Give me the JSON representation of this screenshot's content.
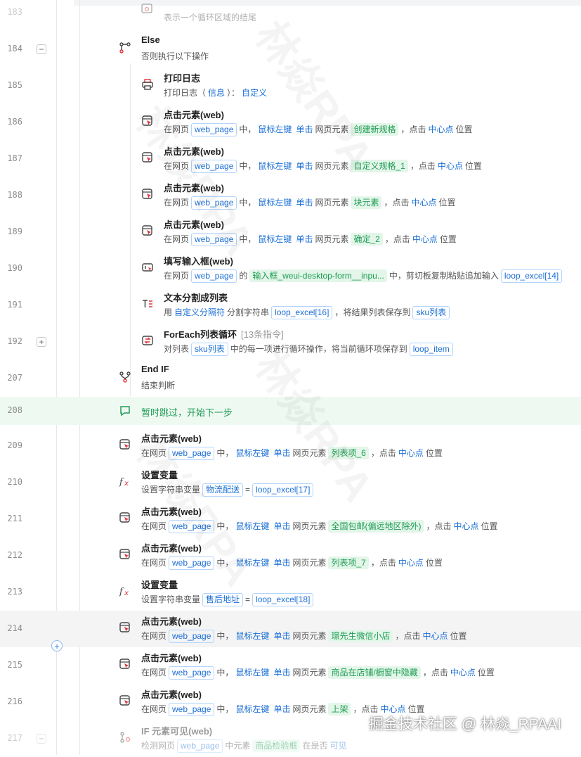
{
  "top_partial_desc": "表示一个循环区域的结尾",
  "top_partial_line": "183",
  "rows": [
    {
      "line": "184",
      "title": "Else",
      "desc": [
        {
          "t": "txt",
          "v": "否则执行以下操作"
        }
      ]
    },
    {
      "line": "185",
      "title": "打印日志",
      "desc": [
        {
          "t": "txt",
          "v": "打印日志（"
        },
        {
          "t": "link",
          "v": "信息"
        },
        {
          "t": "txt",
          "v": "）："
        },
        {
          "t": "link",
          "v": "自定义"
        }
      ]
    },
    {
      "line": "186",
      "title": "点击元素(web)",
      "desc": [
        {
          "t": "txt",
          "v": "在网页"
        },
        {
          "t": "tagb",
          "v": "web_page"
        },
        {
          "t": "txt",
          "v": "中，"
        },
        {
          "t": "link",
          "v": "鼠标左键"
        },
        {
          "t": "link",
          "v": "单击"
        },
        {
          "t": "txt",
          "v": "网页元素"
        },
        {
          "t": "tagg",
          "v": "创建新规格"
        },
        {
          "t": "txt",
          "v": "，点击"
        },
        {
          "t": "link",
          "v": "中心点"
        },
        {
          "t": "txt",
          "v": "位置"
        }
      ]
    },
    {
      "line": "187",
      "title": "点击元素(web)",
      "desc": [
        {
          "t": "txt",
          "v": "在网页"
        },
        {
          "t": "tagb",
          "v": "web_page"
        },
        {
          "t": "txt",
          "v": "中，"
        },
        {
          "t": "link",
          "v": "鼠标左键"
        },
        {
          "t": "link",
          "v": "单击"
        },
        {
          "t": "txt",
          "v": "网页元素"
        },
        {
          "t": "tagg",
          "v": "自定义规格_1"
        },
        {
          "t": "txt",
          "v": "，点击"
        },
        {
          "t": "link",
          "v": "中心点"
        },
        {
          "t": "txt",
          "v": "位置"
        }
      ]
    },
    {
      "line": "188",
      "title": "点击元素(web)",
      "desc": [
        {
          "t": "txt",
          "v": "在网页"
        },
        {
          "t": "tagb",
          "v": "web_page"
        },
        {
          "t": "txt",
          "v": "中，"
        },
        {
          "t": "link",
          "v": "鼠标左键"
        },
        {
          "t": "link",
          "v": "单击"
        },
        {
          "t": "txt",
          "v": "网页元素"
        },
        {
          "t": "tagg",
          "v": "块元素"
        },
        {
          "t": "txt",
          "v": "，点击"
        },
        {
          "t": "link",
          "v": "中心点"
        },
        {
          "t": "txt",
          "v": "位置"
        }
      ]
    },
    {
      "line": "189",
      "title": "点击元素(web)",
      "desc": [
        {
          "t": "txt",
          "v": "在网页"
        },
        {
          "t": "tagb",
          "v": "web_page"
        },
        {
          "t": "txt",
          "v": "中，"
        },
        {
          "t": "link",
          "v": "鼠标左键"
        },
        {
          "t": "link",
          "v": "单击"
        },
        {
          "t": "txt",
          "v": "网页元素"
        },
        {
          "t": "tagg",
          "v": "确定_2"
        },
        {
          "t": "txt",
          "v": "，点击"
        },
        {
          "t": "link",
          "v": "中心点"
        },
        {
          "t": "txt",
          "v": "位置"
        }
      ]
    },
    {
      "line": "190",
      "title": "填写输入框(web)",
      "desc": [
        {
          "t": "txt",
          "v": "在网页"
        },
        {
          "t": "tagb",
          "v": "web_page"
        },
        {
          "t": "txt",
          "v": "的"
        },
        {
          "t": "tagg",
          "v": "输入框_weui-desktop-form__inpu..."
        },
        {
          "t": "txt",
          "v": "中，剪切板复制粘贴追加输入"
        },
        {
          "t": "tagb",
          "v": "loop_excel[14]"
        }
      ]
    },
    {
      "line": "191",
      "title": "文本分割成列表",
      "desc": [
        {
          "t": "txt",
          "v": "用"
        },
        {
          "t": "link",
          "v": "自定义分隔符"
        },
        {
          "t": "txt",
          "v": "分割字符串"
        },
        {
          "t": "tagb",
          "v": "loop_excel[16]"
        },
        {
          "t": "txt",
          "v": "，将结果列表保存到"
        },
        {
          "t": "tagb",
          "v": "sku列表"
        }
      ]
    },
    {
      "line": "192",
      "title": "ForEach列表循环",
      "sub": "[13条指令]",
      "desc": [
        {
          "t": "txt",
          "v": "对列表"
        },
        {
          "t": "tagb",
          "v": "sku列表"
        },
        {
          "t": "txt",
          "v": "中的每一项进行循环操作，将当前循环项保存到"
        },
        {
          "t": "tagb",
          "v": "loop_item"
        }
      ]
    },
    {
      "line": "207",
      "title": "End IF",
      "desc": [
        {
          "t": "txt",
          "v": "结束判断"
        }
      ]
    },
    {
      "line": "208",
      "title": "暂时跳过，开始下一步",
      "desc": []
    },
    {
      "line": "209",
      "title": "点击元素(web)",
      "desc": [
        {
          "t": "txt",
          "v": "在网页"
        },
        {
          "t": "tagb",
          "v": "web_page"
        },
        {
          "t": "txt",
          "v": "中，"
        },
        {
          "t": "link",
          "v": "鼠标左键"
        },
        {
          "t": "link",
          "v": "单击"
        },
        {
          "t": "txt",
          "v": "网页元素"
        },
        {
          "t": "tagg",
          "v": "列表项_6"
        },
        {
          "t": "txt",
          "v": "，点击"
        },
        {
          "t": "link",
          "v": "中心点"
        },
        {
          "t": "txt",
          "v": "位置"
        }
      ]
    },
    {
      "line": "210",
      "title": "设置变量",
      "desc": [
        {
          "t": "txt",
          "v": "设置字符串变量"
        },
        {
          "t": "tagb",
          "v": "物流配送"
        },
        {
          "t": "txt",
          "v": "="
        },
        {
          "t": "tagb",
          "v": "loop_excel[17]"
        }
      ]
    },
    {
      "line": "211",
      "title": "点击元素(web)",
      "desc": [
        {
          "t": "txt",
          "v": "在网页"
        },
        {
          "t": "tagb",
          "v": "web_page"
        },
        {
          "t": "txt",
          "v": "中，"
        },
        {
          "t": "link",
          "v": "鼠标左键"
        },
        {
          "t": "link",
          "v": "单击"
        },
        {
          "t": "txt",
          "v": "网页元素"
        },
        {
          "t": "tagg",
          "v": "全国包邮(偏远地区除外)"
        },
        {
          "t": "txt",
          "v": "，点击"
        },
        {
          "t": "link",
          "v": "中心点"
        },
        {
          "t": "txt",
          "v": "位置"
        }
      ]
    },
    {
      "line": "212",
      "title": "点击元素(web)",
      "desc": [
        {
          "t": "txt",
          "v": "在网页"
        },
        {
          "t": "tagb",
          "v": "web_page"
        },
        {
          "t": "txt",
          "v": "中，"
        },
        {
          "t": "link",
          "v": "鼠标左键"
        },
        {
          "t": "link",
          "v": "单击"
        },
        {
          "t": "txt",
          "v": "网页元素"
        },
        {
          "t": "tagg",
          "v": "列表项_7"
        },
        {
          "t": "txt",
          "v": "，点击"
        },
        {
          "t": "link",
          "v": "中心点"
        },
        {
          "t": "txt",
          "v": "位置"
        }
      ]
    },
    {
      "line": "213",
      "title": "设置变量",
      "desc": [
        {
          "t": "txt",
          "v": "设置字符串变量"
        },
        {
          "t": "tagb",
          "v": "售后地址"
        },
        {
          "t": "txt",
          "v": "="
        },
        {
          "t": "tagb",
          "v": "loop_excel[18]"
        }
      ]
    },
    {
      "line": "214",
      "title": "点击元素(web)",
      "desc": [
        {
          "t": "txt",
          "v": "在网页"
        },
        {
          "t": "tagb",
          "v": "web_page"
        },
        {
          "t": "txt",
          "v": "中，"
        },
        {
          "t": "link",
          "v": "鼠标左键"
        },
        {
          "t": "link",
          "v": "单击"
        },
        {
          "t": "txt",
          "v": "网页元素"
        },
        {
          "t": "tagg",
          "v": "璟先生微信小店"
        },
        {
          "t": "txt",
          "v": "，点击"
        },
        {
          "t": "link",
          "v": "中心点"
        },
        {
          "t": "txt",
          "v": "位置"
        }
      ]
    },
    {
      "line": "215",
      "title": "点击元素(web)",
      "desc": [
        {
          "t": "txt",
          "v": "在网页"
        },
        {
          "t": "tagb",
          "v": "web_page"
        },
        {
          "t": "txt",
          "v": "中，"
        },
        {
          "t": "link",
          "v": "鼠标左键"
        },
        {
          "t": "link",
          "v": "单击"
        },
        {
          "t": "txt",
          "v": "网页元素"
        },
        {
          "t": "tagg",
          "v": "商品在店铺/橱窗中隐藏"
        },
        {
          "t": "txt",
          "v": "，点击"
        },
        {
          "t": "link",
          "v": "中心点"
        },
        {
          "t": "txt",
          "v": "位置"
        }
      ]
    },
    {
      "line": "216",
      "title": "点击元素(web)",
      "desc": [
        {
          "t": "txt",
          "v": "在网页"
        },
        {
          "t": "tagb",
          "v": "web_page"
        },
        {
          "t": "txt",
          "v": "中，"
        },
        {
          "t": "link",
          "v": "鼠标左键"
        },
        {
          "t": "link",
          "v": "单击"
        },
        {
          "t": "txt",
          "v": "网页元素"
        },
        {
          "t": "tagg",
          "v": "上架"
        },
        {
          "t": "txt",
          "v": "，点击"
        },
        {
          "t": "link",
          "v": "中心点"
        },
        {
          "t": "txt",
          "v": "位置"
        }
      ]
    },
    {
      "line": "217",
      "title": "IF 元素可见(web)",
      "desc": [
        {
          "t": "txt",
          "v": "检测网页"
        },
        {
          "t": "tagb",
          "v": "web_page"
        },
        {
          "t": "txt",
          "v": "中元素"
        },
        {
          "t": "tagg",
          "v": "商品检验框"
        },
        {
          "t": "txt",
          "v": "在是否"
        },
        {
          "t": "link",
          "v": "可见"
        }
      ]
    }
  ],
  "collapse_collapse_symbol": "−",
  "collapse_expand_symbol": "+",
  "add_symbol": "+",
  "watermark_text": "林焱RPA",
  "footer_watermark": "掘金技术社区 @ 林焱_RPAAI",
  "colors": {
    "link": "#1b6fd6",
    "tag_green": "#1f9d55",
    "comment": "#1f9d55"
  }
}
